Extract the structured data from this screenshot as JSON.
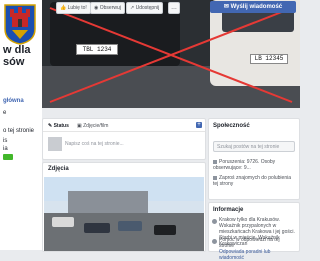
{
  "page": {
    "name": "…w dla …sów",
    "name_line1": "w dla",
    "name_line2": "sów"
  },
  "sidebar": {
    "items": [
      {
        "label": "główna",
        "active": true
      },
      {
        "label": "e"
      },
      {
        "label": "o tej stronie"
      },
      {
        "label": "is"
      },
      {
        "label": "ia"
      }
    ]
  },
  "cover": {
    "plate_left": "TBL 1234",
    "plate_right": "LB 12345"
  },
  "top_actions": {
    "like": "Lubię to!",
    "follow": "Obserwuj",
    "share": "Udostępnij",
    "more": "…",
    "send_message": "Wyślij wiadomość"
  },
  "composer": {
    "tab_status": "Status",
    "tab_photo": "Zdjęcie/film",
    "placeholder": "Napisz coś na tej stronie..."
  },
  "photos": {
    "title": "Zdjęcia"
  },
  "community": {
    "title": "Społeczność",
    "search_placeholder": "Szukaj postów na tej stronie",
    "row1": "Poruszenia: 9726. Osoby obserwujące: 9...",
    "row2": "Zaproś znajomych do polubienia tej strony"
  },
  "info": {
    "title": "Informacje",
    "text1": "Krakow tylko dla Krakusów. Wskaźnik przypalonych w mieszkańcach Krakowa i jej gości. Starbi w mieście. Wskaźnik Krakowiczan",
    "text2": "Pomoc w odpowiedzi na tej stronie",
    "link2": "Odpowiada poradni lub wiadomość"
  }
}
